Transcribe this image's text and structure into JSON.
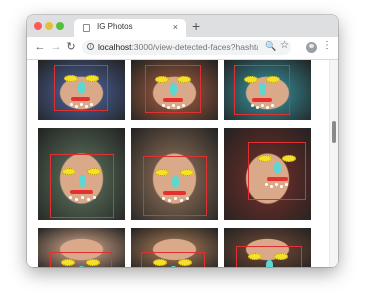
{
  "browser": {
    "tab_title": "IG Photos",
    "tab_close": "×",
    "new_tab": "+",
    "url_host": "localhost",
    "url_rest": ":3000/view-detected-faces?hashtag=f..."
  },
  "icons": {
    "back": "←",
    "forward": "→",
    "reload": "↻",
    "info": "i",
    "zoom": "🔍",
    "star": "☆",
    "menu": "⋮"
  },
  "scroll": {
    "position": 0.33
  },
  "photos": [
    {
      "label": "face-photo-1",
      "bg": "#3f4f77"
    },
    {
      "label": "face-photo-2",
      "bg": "#7a4a36"
    },
    {
      "label": "face-photo-3",
      "bg": "#2f6f77"
    },
    {
      "label": "face-photo-4",
      "bg": "#4a5a4a"
    },
    {
      "label": "face-photo-5",
      "bg": "#6f5948"
    },
    {
      "label": "face-photo-6",
      "bg": "#5a2a26"
    },
    {
      "label": "face-photo-7",
      "bg": "#9a7c68"
    },
    {
      "label": "face-photo-8",
      "bg": "#7f5f45"
    },
    {
      "label": "face-photo-9",
      "bg": "#5a3d30"
    }
  ],
  "colors": {
    "face_box": "#e03030",
    "eye": "#f4e12a",
    "nose": "#5ed6d2",
    "mouth": "#e63030"
  }
}
